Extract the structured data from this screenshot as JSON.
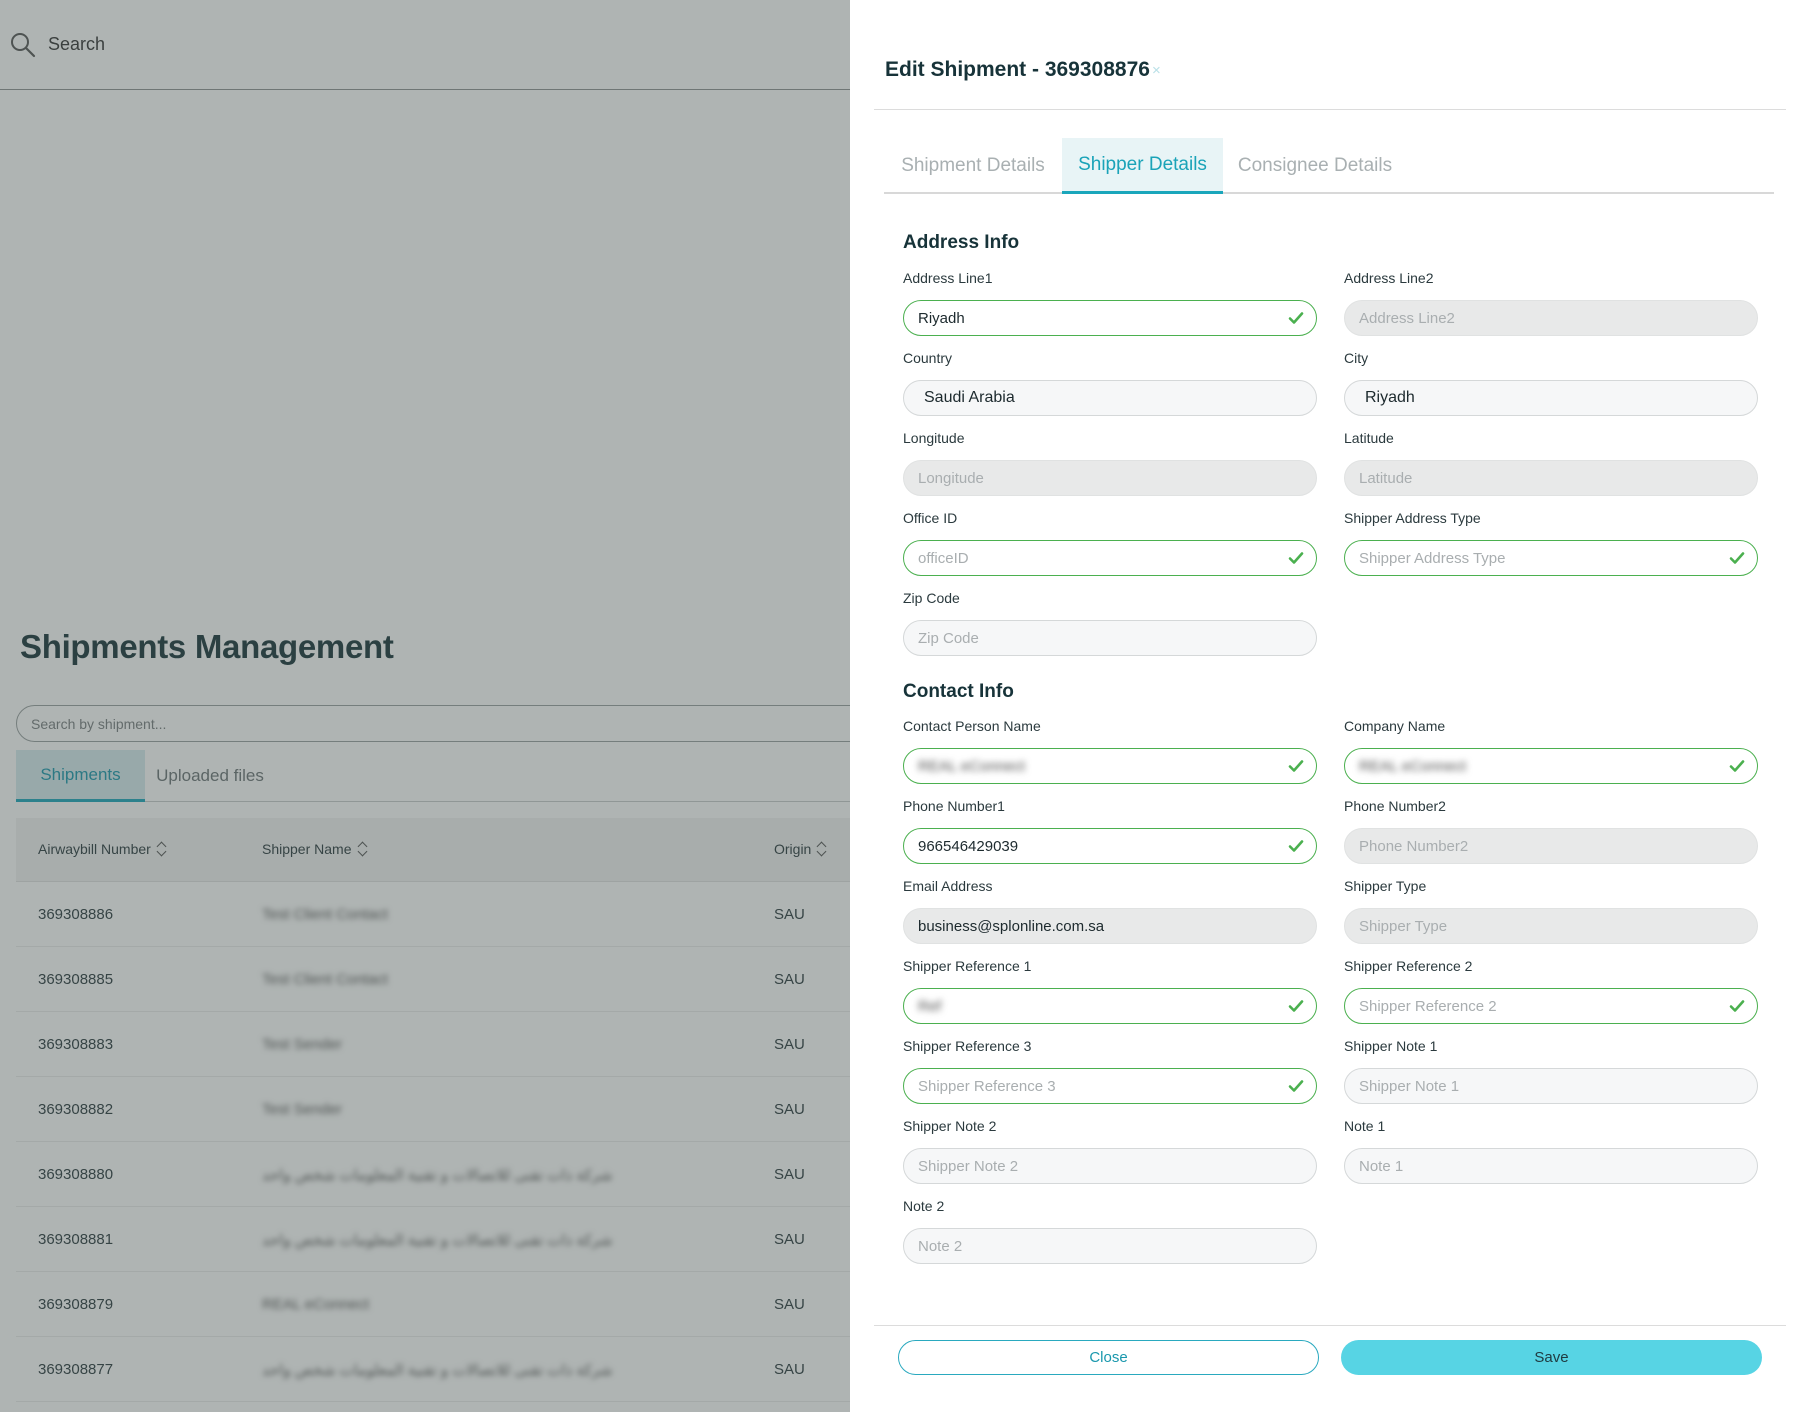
{
  "background": {
    "search_label": "Search",
    "page_title": "Shipments Management",
    "search_placeholder": "Search by shipment...",
    "tabs": [
      "Shipments",
      "Uploaded files"
    ],
    "table": {
      "headers": [
        "Airwaybill Number",
        "Shipper Name",
        "Origin"
      ],
      "rows": [
        {
          "awb": "369308886",
          "shipper": "Test Client Contact",
          "origin": "SAU"
        },
        {
          "awb": "369308885",
          "shipper": "Test Client Contact",
          "origin": "SAU"
        },
        {
          "awb": "369308883",
          "shipper": "Test Sender",
          "origin": "SAU"
        },
        {
          "awb": "369308882",
          "shipper": "Test Sender",
          "origin": "SAU"
        },
        {
          "awb": "369308880",
          "shipper": "شركة ذات تقنى للاتصالات و تقنية المعلومات شخص واحد",
          "origin": "SAU"
        },
        {
          "awb": "369308881",
          "shipper": "شركة ذات تقنى للاتصالات و تقنية المعلومات شخص واحد",
          "origin": "SAU"
        },
        {
          "awb": "369308879",
          "shipper": "REAL eConnect",
          "origin": "SAU"
        },
        {
          "awb": "369308877",
          "shipper": "شركة ذات تقنى للاتصالات و تقنية المعلومات شخص واحد",
          "origin": "SAU"
        }
      ]
    }
  },
  "drawer": {
    "title": "Edit Shipment - 369308876",
    "close_glyph": "×",
    "tabs": [
      "Shipment Details",
      "Shipper Details",
      "Consignee Details"
    ],
    "address_title": "Address Info",
    "contact_title": "Contact Info",
    "fields": {
      "address_line1": {
        "label": "Address Line1",
        "value": "Riyadh",
        "placeholder": ""
      },
      "address_line2": {
        "label": "Address Line2",
        "value": "",
        "placeholder": "Address Line2"
      },
      "country": {
        "label": "Country",
        "value": "Saudi Arabia",
        "placeholder": ""
      },
      "city": {
        "label": "City",
        "value": "Riyadh",
        "placeholder": ""
      },
      "longitude": {
        "label": "Longitude",
        "value": "",
        "placeholder": "Longitude"
      },
      "latitude": {
        "label": "Latitude",
        "value": "",
        "placeholder": "Latitude"
      },
      "office_id": {
        "label": "Office ID",
        "value": "",
        "placeholder": "officeID"
      },
      "shipper_address_type": {
        "label": "Shipper Address Type",
        "value": "",
        "placeholder": "Shipper Address Type"
      },
      "zip_code": {
        "label": "Zip Code",
        "value": "",
        "placeholder": "Zip Code"
      },
      "contact_person_name": {
        "label": "Contact Person Name",
        "value": "REAL eConnect",
        "placeholder": ""
      },
      "company_name": {
        "label": "Company Name",
        "value": "REAL eConnect",
        "placeholder": ""
      },
      "phone_number1": {
        "label": "Phone Number1",
        "value": "966546429039",
        "placeholder": ""
      },
      "phone_number2": {
        "label": "Phone Number2",
        "value": "",
        "placeholder": "Phone Number2"
      },
      "email_address": {
        "label": "Email Address",
        "value": "business@splonline.com.sa",
        "placeholder": ""
      },
      "shipper_type": {
        "label": "Shipper Type",
        "value": "",
        "placeholder": "Shipper Type"
      },
      "shipper_reference_1": {
        "label": "Shipper Reference 1",
        "value": "Ref",
        "placeholder": ""
      },
      "shipper_reference_2": {
        "label": "Shipper Reference 2",
        "value": "",
        "placeholder": "Shipper Reference 2"
      },
      "shipper_reference_3": {
        "label": "Shipper Reference 3",
        "value": "",
        "placeholder": "Shipper Reference 3"
      },
      "shipper_note_1": {
        "label": "Shipper Note 1",
        "value": "",
        "placeholder": "Shipper Note 1"
      },
      "shipper_note_2": {
        "label": "Shipper Note 2",
        "value": "",
        "placeholder": "Shipper Note 2"
      },
      "note_1": {
        "label": "Note 1",
        "value": "",
        "placeholder": "Note 1"
      },
      "note_2": {
        "label": "Note 2",
        "value": "",
        "placeholder": "Note 2"
      }
    },
    "buttons": {
      "close": "Close",
      "save": "Save"
    }
  },
  "colors": {
    "accent": "#1aa6bb",
    "save_button": "#57d4e4",
    "valid_border": "#4bb04f",
    "title": "#173339"
  },
  "icons": {
    "search": "search-icon",
    "valid": "check-icon",
    "sort": "sort-icon",
    "close": "close-icon"
  }
}
